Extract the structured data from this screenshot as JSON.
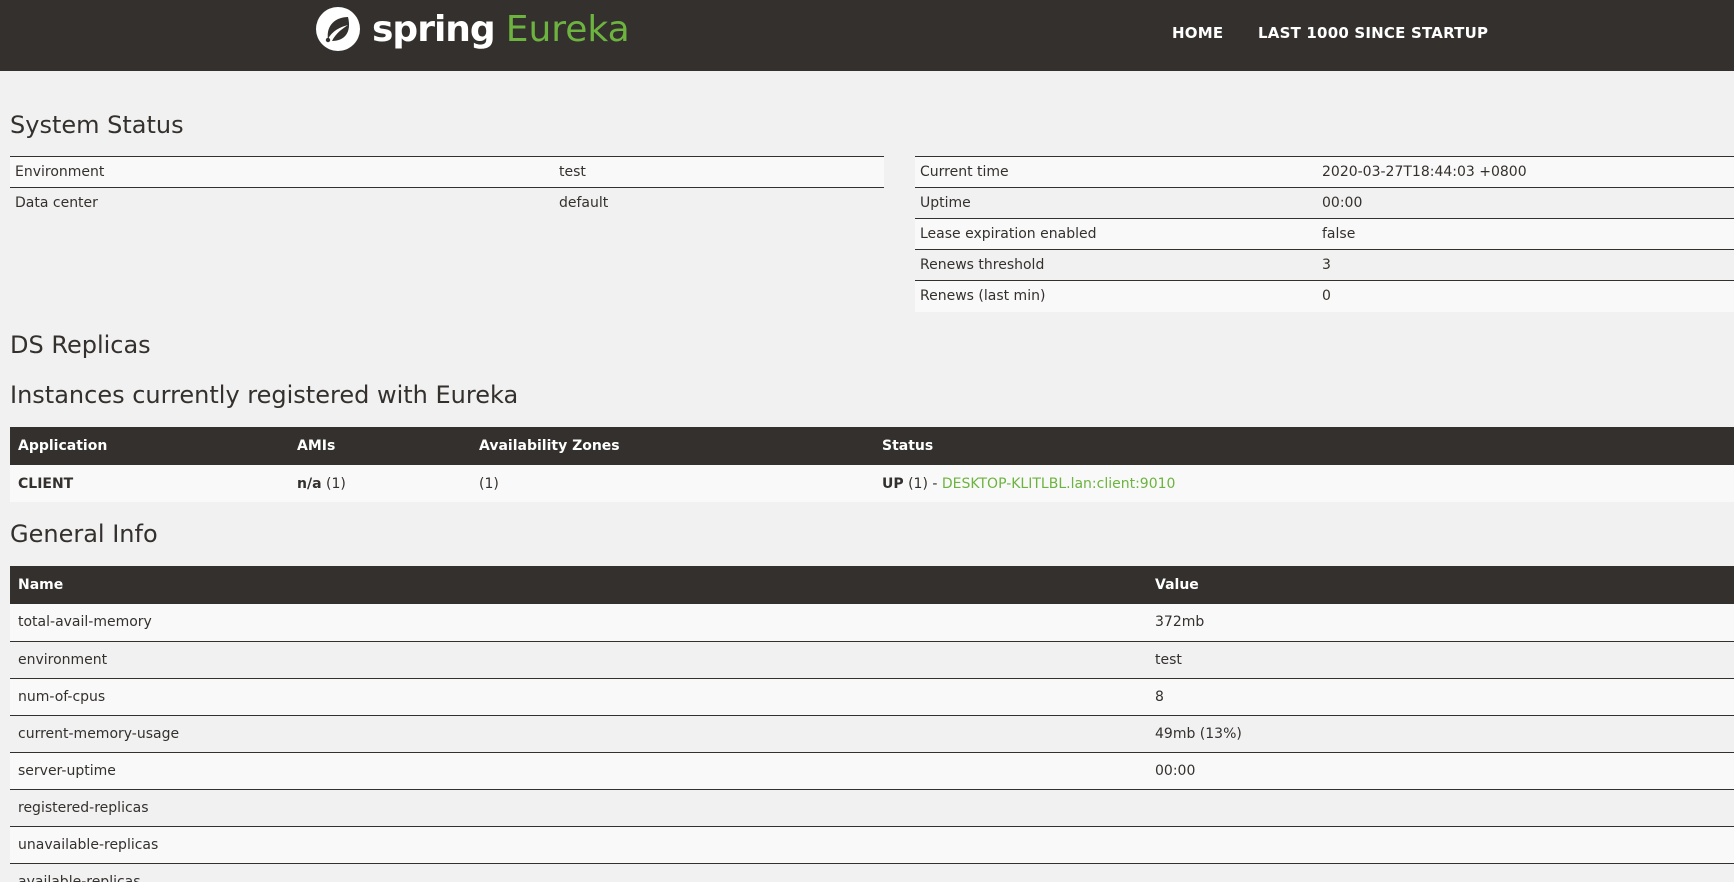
{
  "navbar": {
    "brand_spring": "spring",
    "brand_eureka": "Eureka",
    "links": [
      "HOME",
      "LAST 1000 SINCE STARTUP"
    ]
  },
  "headings": {
    "system_status": "System Status",
    "ds_replicas": "DS Replicas",
    "instances": "Instances currently registered with Eureka",
    "general_info": "General Info"
  },
  "system_status_left": [
    {
      "label": "Environment",
      "value": "test"
    },
    {
      "label": "Data center",
      "value": "default"
    }
  ],
  "system_status_right": [
    {
      "label": "Current time",
      "value": "2020-03-27T18:44:03 +0800"
    },
    {
      "label": "Uptime",
      "value": "00:00"
    },
    {
      "label": "Lease expiration enabled",
      "value": "false"
    },
    {
      "label": "Renews threshold",
      "value": "3"
    },
    {
      "label": "Renews (last min)",
      "value": "0"
    }
  ],
  "instances_table": {
    "headers": [
      "Application",
      "AMIs",
      "Availability Zones",
      "Status"
    ],
    "rows": [
      {
        "application": "CLIENT",
        "amis_bold": "n/a",
        "amis_count": "(1)",
        "zones": "(1)",
        "status_bold": "UP",
        "status_text": "(1) -",
        "status_link": "DESKTOP-KLITLBL.lan:client:9010"
      }
    ]
  },
  "general_info_table": {
    "headers": [
      "Name",
      "Value"
    ],
    "rows": [
      {
        "name": "total-avail-memory",
        "value": "372mb"
      },
      {
        "name": "environment",
        "value": "test"
      },
      {
        "name": "num-of-cpus",
        "value": "8"
      },
      {
        "name": "current-memory-usage",
        "value": "49mb (13%)"
      },
      {
        "name": "server-uptime",
        "value": "00:00"
      },
      {
        "name": "registered-replicas",
        "value": ""
      },
      {
        "name": "unavailable-replicas",
        "value": ""
      },
      {
        "name": "available-replicas",
        "value": ""
      }
    ]
  },
  "colors": {
    "navbar": "#34302d",
    "accent_green": "#6db33f",
    "background": "#f1f1f1"
  },
  "icons": {
    "brand_logo": "spring-leaf-icon"
  }
}
